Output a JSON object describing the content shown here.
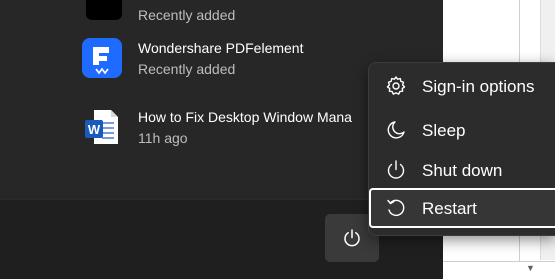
{
  "recommended": [
    {
      "title": "",
      "subtitle": "Recently added",
      "icon": "app-icon"
    },
    {
      "title": "Wondershare PDFelement",
      "subtitle": "Recently added",
      "icon": "pdfelement-icon"
    },
    {
      "title": "How to Fix Desktop Window Mana",
      "subtitle": "11h ago",
      "icon": "word-document-icon"
    }
  ],
  "power_menu": {
    "items": [
      {
        "label": "Sign-in options",
        "icon": "gear-icon"
      },
      {
        "label": "Sleep",
        "icon": "moon-icon"
      },
      {
        "label": "Shut down",
        "icon": "power-icon"
      },
      {
        "label": "Restart",
        "icon": "restart-icon"
      }
    ]
  },
  "colors": {
    "panel": "#272727",
    "footer": "#1f1f1f",
    "menu": "#2c2c2c",
    "pdfelement_blue": "#1f6bff",
    "word_blue": "#185abd"
  }
}
